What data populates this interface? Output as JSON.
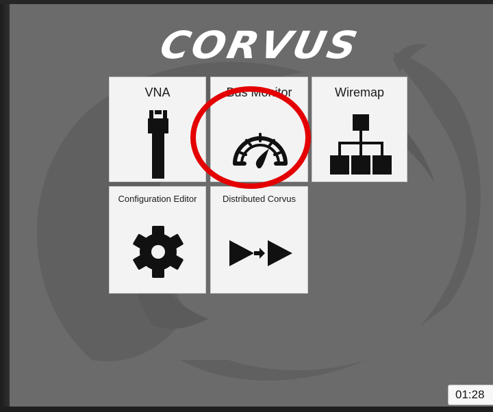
{
  "app": {
    "logo_text": "CORVUS"
  },
  "tiles": [
    {
      "label": "VNA",
      "icon": "ethernet-plug-icon"
    },
    {
      "label": "Bus Monitor",
      "icon": "speedometer-icon"
    },
    {
      "label": "Wiremap",
      "icon": "network-tree-icon"
    },
    {
      "label": "Configuration Editor",
      "icon": "gear-icon"
    },
    {
      "label": "Distributed Corvus",
      "icon": "double-arrow-icon"
    }
  ],
  "status": {
    "clock": "01:28"
  },
  "colors": {
    "screen_bg": "#6b6b6b",
    "tile_bg": "#f3f3f3",
    "highlight": "#e40000",
    "icon": "#111111"
  }
}
